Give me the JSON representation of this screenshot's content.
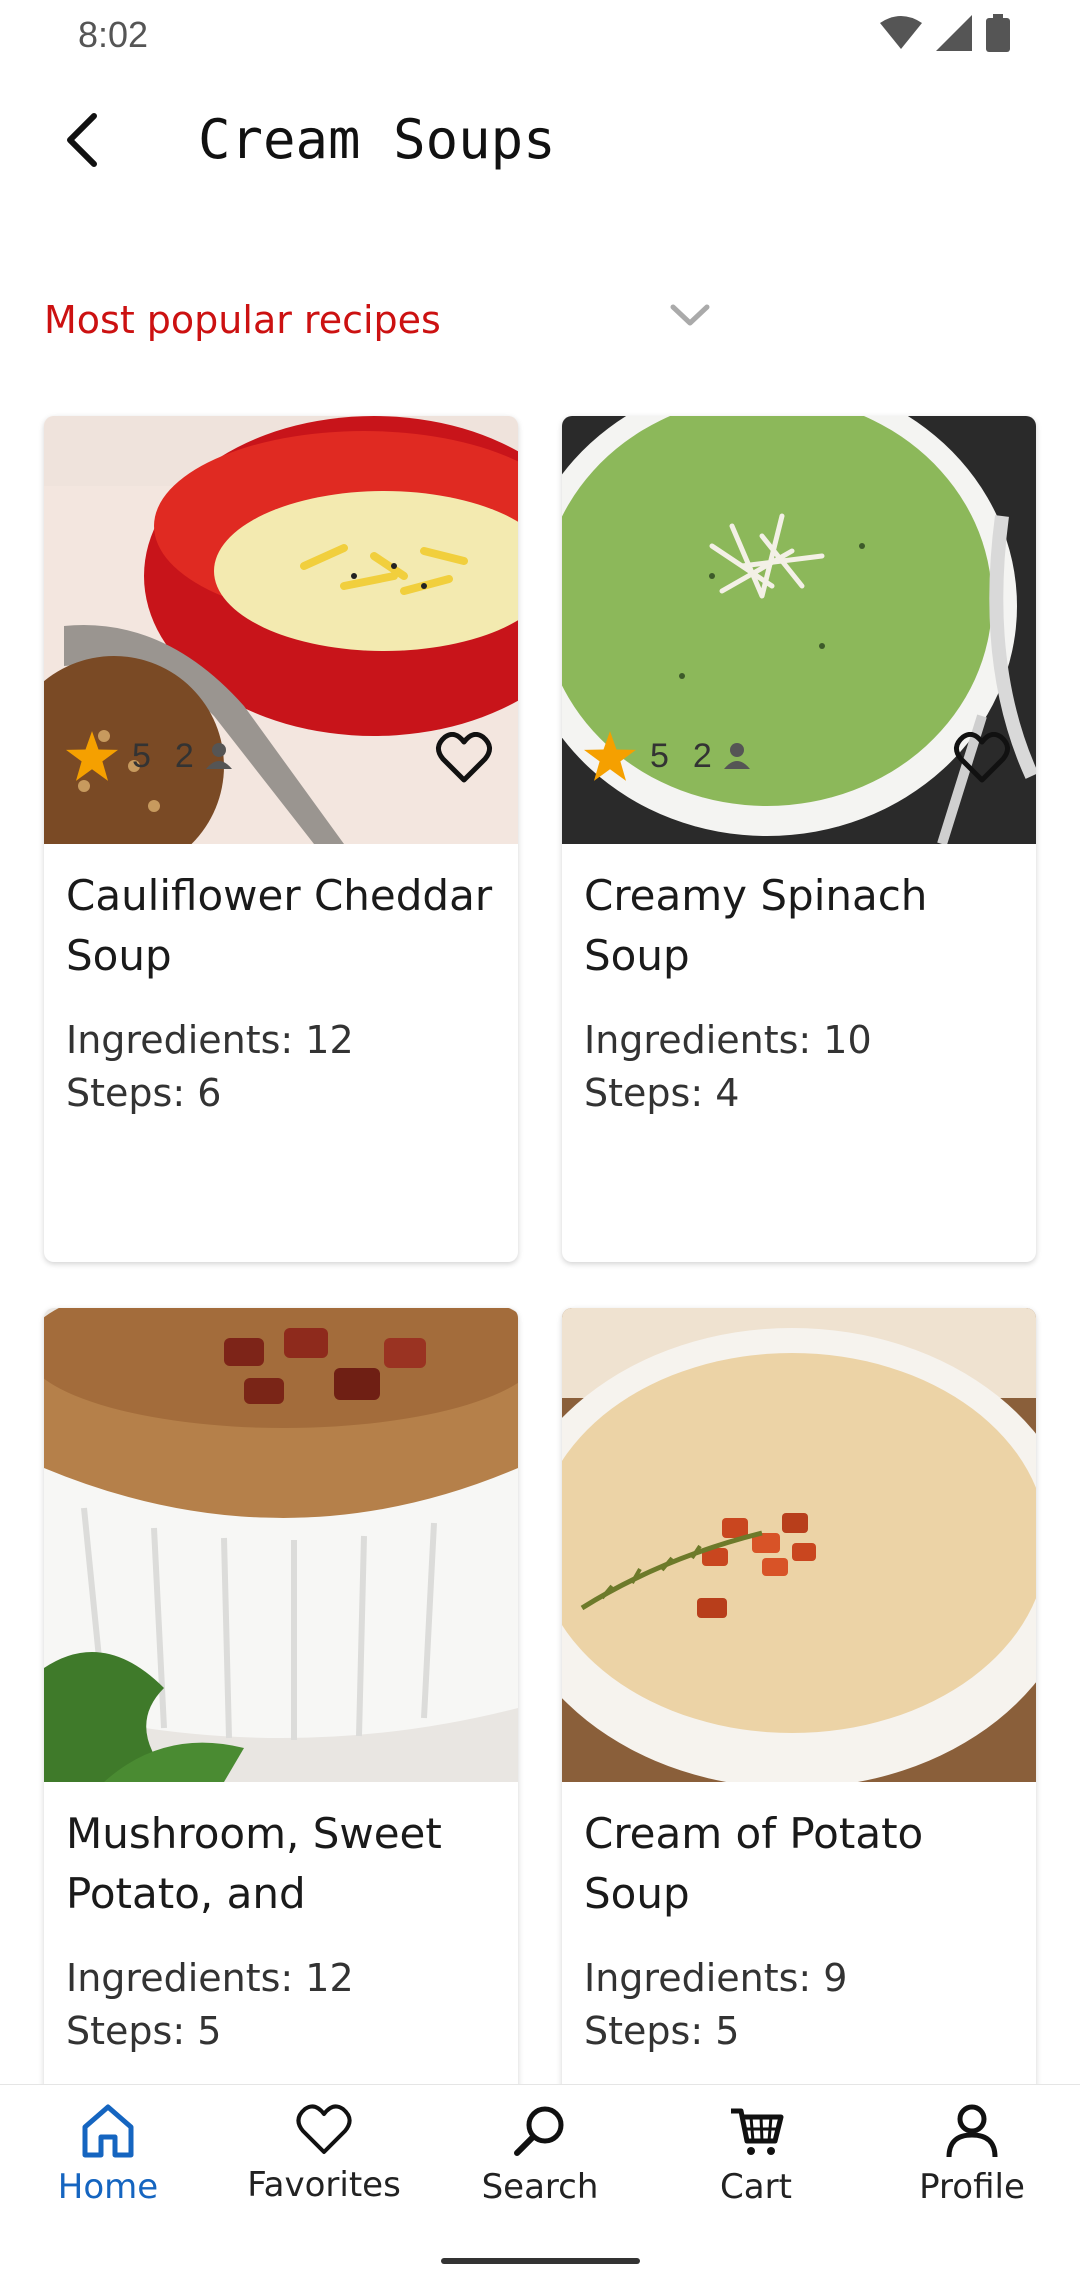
{
  "status_bar": {
    "time": "8:02"
  },
  "app_bar": {
    "title": "Cream Soups"
  },
  "sort": {
    "label": "Most popular recipes"
  },
  "recipes": [
    {
      "title": "Cauliflower Cheddar Soup",
      "ingredients": "Ingredients: 12",
      "steps": "Steps: 6",
      "rating": "5",
      "reviews": "2"
    },
    {
      "title": "Creamy Spinach Soup",
      "ingredients": "Ingredients: 10",
      "steps": "Steps: 4",
      "rating": "5",
      "reviews": "2"
    },
    {
      "title": "Mushroom, Sweet Potato, and Smoke…",
      "ingredients": "Ingredients: 12",
      "steps": "Steps: 5"
    },
    {
      "title": "Cream of Potato Soup",
      "ingredients": "Ingredients: 9",
      "steps": "Steps: 5"
    }
  ],
  "bottom_nav": [
    {
      "label": "Home",
      "icon": "home-icon",
      "active": true
    },
    {
      "label": "Favorites",
      "icon": "heart-icon"
    },
    {
      "label": "Search",
      "icon": "search-icon"
    },
    {
      "label": "Cart",
      "icon": "cart-icon"
    },
    {
      "label": "Profile",
      "icon": "person-icon"
    }
  ],
  "colors": {
    "accent": "#cc1111",
    "nav_active": "#1565c0",
    "star": "#f5a000"
  }
}
